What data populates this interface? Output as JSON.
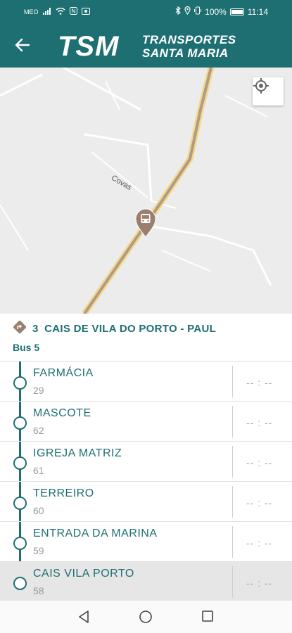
{
  "status_bar": {
    "carrier": "MEO",
    "battery": "100%",
    "time": "11:14"
  },
  "app_bar": {
    "logo_big": "TSM",
    "logo_line1": "TRANSPORTES",
    "logo_line2": "SANTA MARIA"
  },
  "map": {
    "place_label": "Covas"
  },
  "route": {
    "number": "3",
    "name": "CAIS DE VILA DO PORTO - PAUL",
    "bus": "Bus 5"
  },
  "stops": [
    {
      "name": "FARMÁCIA",
      "code": "29",
      "time": "-- : --"
    },
    {
      "name": "MASCOTE",
      "code": "62",
      "time": "-- : --"
    },
    {
      "name": "IGREJA MATRIZ",
      "code": "61",
      "time": "-- : --"
    },
    {
      "name": "TERREIRO",
      "code": "60",
      "time": "-- : --"
    },
    {
      "name": "ENTRADA DA MARINA",
      "code": "59",
      "time": "-- : --"
    },
    {
      "name": "CAIS VILA PORTO",
      "code": "58",
      "time": "-- : --"
    }
  ],
  "colors": {
    "primary": "#1e6f72",
    "road": "#b29a86",
    "road_edge": "#f1d98a"
  },
  "icons": {
    "back": "back-arrow-icon",
    "locate": "crosshair-locate-icon",
    "bus_marker": "bus-pin-icon",
    "route": "diamond-turn-icon"
  }
}
